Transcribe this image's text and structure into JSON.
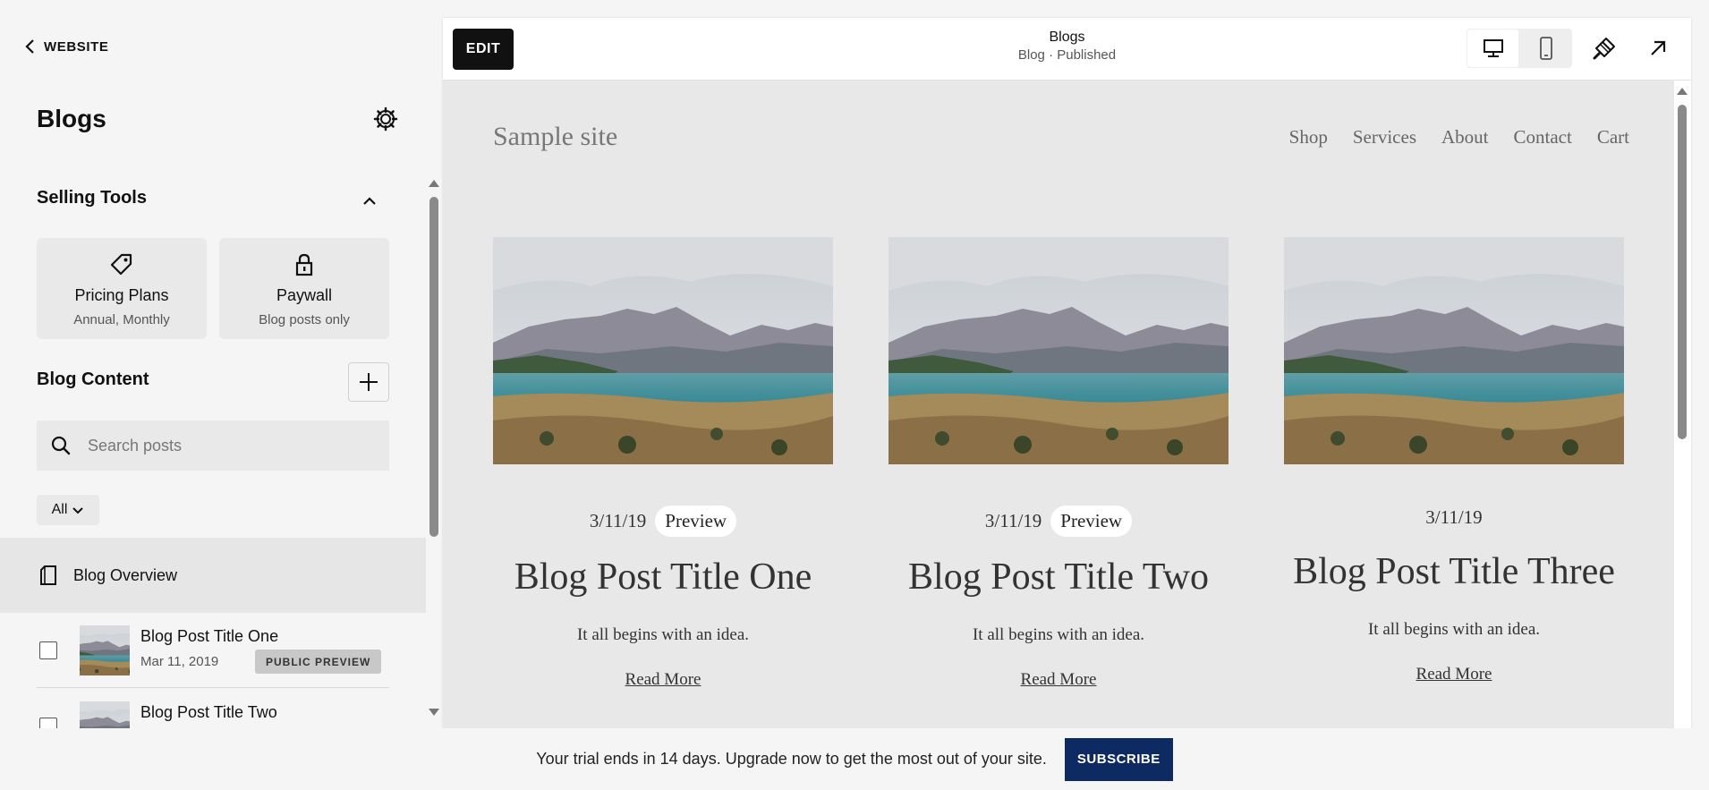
{
  "left_panel": {
    "back_label": "WEBSITE",
    "title": "Blogs",
    "selling_tools": {
      "title": "Selling Tools",
      "cards": [
        {
          "title": "Pricing Plans",
          "subtitle": "Annual, Monthly",
          "icon": "tag-icon"
        },
        {
          "title": "Paywall",
          "subtitle": "Blog posts only",
          "icon": "lock-icon"
        }
      ]
    },
    "blog_content": {
      "title": "Blog Content",
      "search_placeholder": "Search posts",
      "filter_label": "All",
      "overview_label": "Blog Overview",
      "posts": [
        {
          "title": "Blog Post Title One",
          "date": "Mar 11, 2019",
          "badge": "PUBLIC PREVIEW"
        },
        {
          "title": "Blog Post Title Two",
          "date": "",
          "badge": ""
        }
      ]
    }
  },
  "topbar": {
    "edit_label": "EDIT",
    "title": "Blogs",
    "subtitle": "Blog · Published"
  },
  "site": {
    "logo": "Sample site",
    "nav": [
      "Shop",
      "Services",
      "About",
      "Contact",
      "Cart"
    ],
    "posts": [
      {
        "date": "3/11/19",
        "preview": "Preview",
        "title": "Blog Post Title One",
        "excerpt": "It all begins with an idea.",
        "read_more": "Read More"
      },
      {
        "date": "3/11/19",
        "preview": "Preview",
        "title": "Blog Post Title Two",
        "excerpt": "It all begins with an idea.",
        "read_more": "Read More"
      },
      {
        "date": "3/11/19",
        "preview": "",
        "title": "Blog Post Title Three",
        "excerpt": "It all begins with an idea.",
        "read_more": "Read More"
      }
    ]
  },
  "trial_bar": {
    "text": "Your trial ends in 14 days. Upgrade now to get the most out of your site.",
    "button": "SUBSCRIBE"
  },
  "colors": {
    "subscribe": "#0e2a63",
    "edit_button": "#111111",
    "site_background": "#e8e8e8"
  }
}
